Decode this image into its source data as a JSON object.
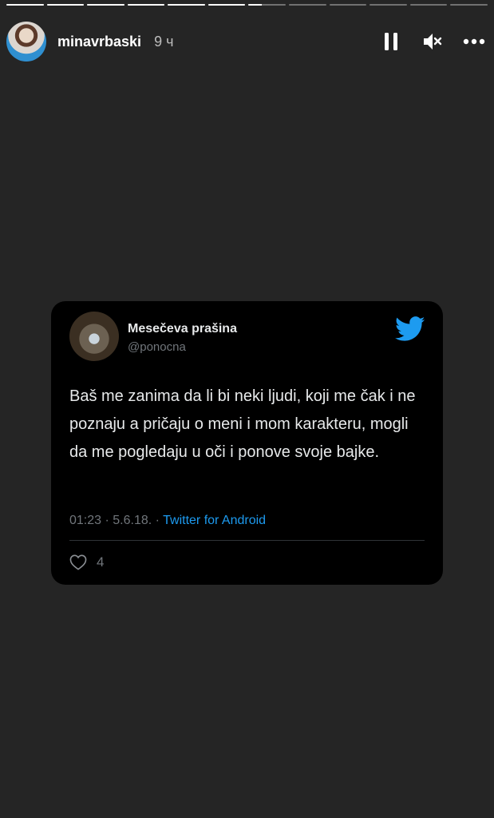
{
  "story": {
    "segments": [
      1,
      1,
      1,
      1,
      1,
      1,
      0.35,
      0,
      0,
      0,
      0,
      0
    ]
  },
  "header": {
    "username": "minavrbaski",
    "time": "9 ч",
    "icons": [
      "pause-icon",
      "mute-icon",
      "more-icon"
    ]
  },
  "tweet": {
    "display_name": "Mesečeva prašina",
    "handle": "@ponocna",
    "text": "Baš me zanima da li bi neki ljudi, koji me čak i ne poznaju a pričaju o meni i mom karakteru, mogli da me pogledaju u oči i ponove svoje bajke.",
    "time_date": "01:23 · 5.6.18. · ",
    "source": "Twitter for Android",
    "likes": "4",
    "icons": [
      "twitter-bird-icon",
      "heart-icon"
    ]
  },
  "colors": {
    "background": "#252525",
    "card": "#000000",
    "link": "#1d9bf0",
    "twitter_blue": "#1d9bf0"
  }
}
